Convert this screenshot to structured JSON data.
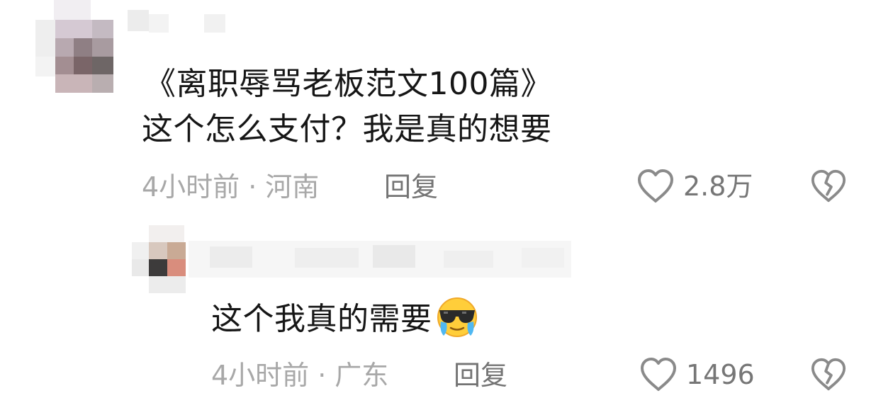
{
  "comments": [
    {
      "text_line1": "《离职辱骂老板范文100篇》",
      "text_line2": "这个怎么支付？我是真的想要",
      "time": "4小时前",
      "separator": "·",
      "location": "河南",
      "reply_label": "回复",
      "like_count": "2.8万",
      "icons": {
        "like": "heart-outline-icon",
        "dislike": "broken-heart-icon"
      }
    },
    {
      "text": "这个我真的需要",
      "emoji": "crying-cool-sunglasses-emoji",
      "time": "4小时前",
      "separator": "·",
      "location": "广东",
      "reply_label": "回复",
      "like_count": "1496",
      "icons": {
        "like": "heart-outline-icon",
        "dislike": "broken-heart-icon"
      }
    }
  ],
  "colors": {
    "text": "#161616",
    "meta": "#a8a8a8",
    "reply": "#747474",
    "icon": "#8a8a8a"
  }
}
